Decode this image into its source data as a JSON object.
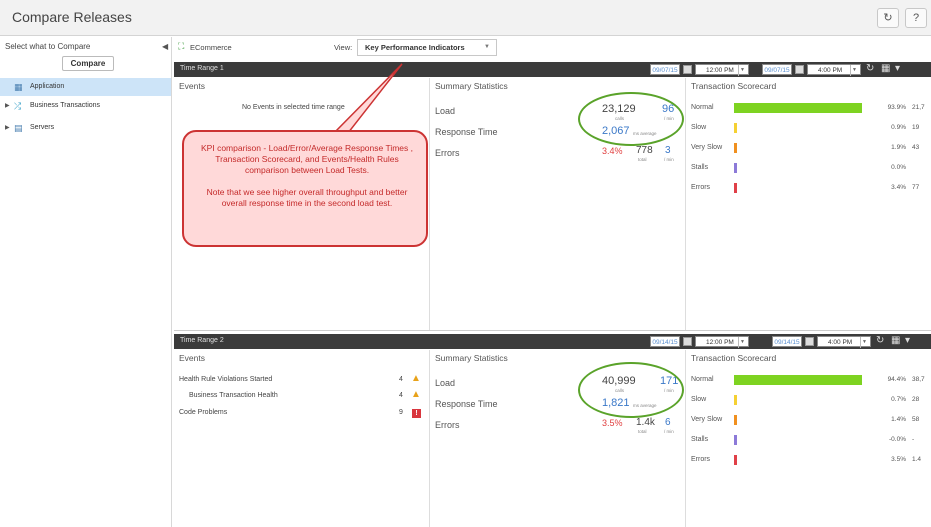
{
  "app": {
    "title": "Compare Releases"
  },
  "toolbar": {
    "refresh_icon": "↻",
    "help_icon": "?"
  },
  "sidebar": {
    "label": "Select what to Compare",
    "compare_label": "Compare",
    "items": [
      {
        "label": "Application",
        "icon": "application-icon",
        "selected": true
      },
      {
        "label": "Business Transactions",
        "icon": "business-transactions-icon",
        "selected": false
      },
      {
        "label": "Servers",
        "icon": "servers-icon",
        "selected": false
      }
    ]
  },
  "context": {
    "app_name": "ECommerce",
    "view_label": "View:",
    "view_value": "Key Performance Indicators"
  },
  "range1": {
    "label": "Time Range 1",
    "start_date": "09/07/15",
    "start_time": "12:00 PM",
    "end_date": "09/07/15",
    "end_time": "4:00 PM",
    "events": {
      "title": "Events",
      "empty_text": "No Events in selected time range"
    },
    "summary": {
      "title": "Summary Statistics",
      "load_label": "Load",
      "load_calls": "23,129",
      "load_calls_unit": "calls",
      "load_rate": "96",
      "load_rate_unit": "/ min",
      "response_label": "Response Time",
      "response_value": "2,067",
      "response_unit": "ms average",
      "errors_label": "Errors",
      "errors_pct": "3.4%",
      "errors_total": "778",
      "errors_total_unit": "total",
      "errors_rate": "3",
      "errors_rate_unit": "/ min"
    },
    "scorecard": {
      "title": "Transaction Scorecard",
      "rows": [
        {
          "label": "Normal",
          "pct": "93.9%",
          "val": "21,7",
          "color": "#7ed321",
          "fill": 0.939
        },
        {
          "label": "Slow",
          "pct": "0.9%",
          "val": "19",
          "color": "#f5d033",
          "fill": 0.009
        },
        {
          "label": "Very Slow",
          "pct": "1.9%",
          "val": "43",
          "color": "#f0901f",
          "fill": 0.019
        },
        {
          "label": "Stalls",
          "pct": "0.0%",
          "val": "",
          "color": "#8c7ad8",
          "fill": 0.0
        },
        {
          "label": "Errors",
          "pct": "3.4%",
          "val": "77",
          "color": "#e04048",
          "fill": 0.034
        }
      ]
    }
  },
  "range2": {
    "label": "Time Range 2",
    "start_date": "09/14/15",
    "start_time": "12:00 PM",
    "end_date": "09/14/15",
    "end_time": "4:00 PM",
    "events": {
      "title": "Events",
      "rows": [
        {
          "label": "Health Rule Violations Started",
          "count": "4",
          "indent": false,
          "type": "warning"
        },
        {
          "label": "Business Transaction Health",
          "count": "4",
          "indent": true,
          "type": "warning"
        },
        {
          "label": "Code Problems",
          "count": "9",
          "indent": false,
          "type": "error"
        }
      ]
    },
    "summary": {
      "title": "Summary Statistics",
      "load_label": "Load",
      "load_calls": "40,999",
      "load_calls_unit": "calls",
      "load_rate": "171",
      "load_rate_unit": "/ min",
      "response_label": "Response Time",
      "response_value": "1,821",
      "response_unit": "ms average",
      "errors_label": "Errors",
      "errors_pct": "3.5%",
      "errors_total": "1.4k",
      "errors_total_unit": "total",
      "errors_rate": "6",
      "errors_rate_unit": "/ min"
    },
    "scorecard": {
      "title": "Transaction Scorecard",
      "rows": [
        {
          "label": "Normal",
          "pct": "94.4%",
          "val": "38,7",
          "color": "#7ed321",
          "fill": 0.944
        },
        {
          "label": "Slow",
          "pct": "0.7%",
          "val": "28",
          "color": "#f5d033",
          "fill": 0.007
        },
        {
          "label": "Very Slow",
          "pct": "1.4%",
          "val": "58",
          "color": "#f0901f",
          "fill": 0.014
        },
        {
          "label": "Stalls",
          "pct": "-0.0%",
          "val": "-",
          "color": "#8c7ad8",
          "fill": 0.0
        },
        {
          "label": "Errors",
          "pct": "3.5%",
          "val": "1.4",
          "color": "#e04048",
          "fill": 0.035
        }
      ]
    }
  },
  "callout": {
    "line1": "KPI comparison - Load/Error/Average Response Times , Transaction Scorecard, and Events/Health Rules comparison between Load Tests.",
    "line2": "Note that we see higher overall throughput and better overall response time in the second load test."
  }
}
